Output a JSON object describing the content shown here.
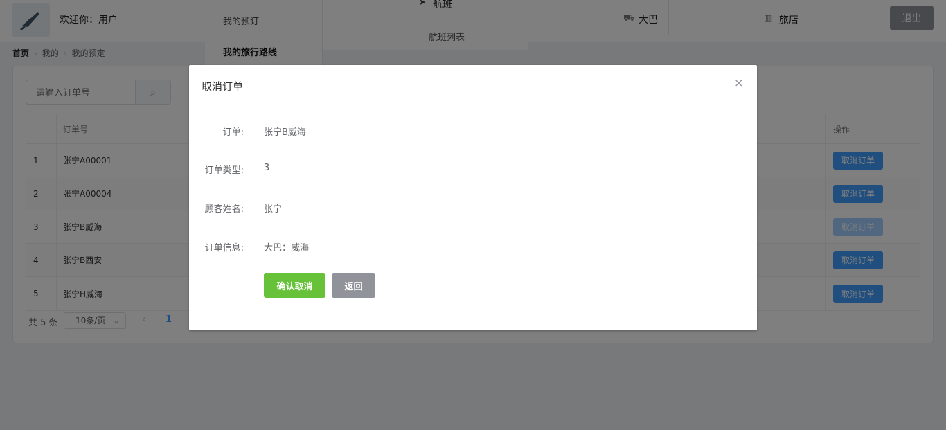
{
  "header": {
    "welcome": "欢迎你：用户",
    "nav": {
      "my_bookings": "我的预订",
      "my_routes": "我的旅行路线",
      "flight": "航班",
      "flight_list": "航班列表",
      "bus": "大巴",
      "hotel": "旅店"
    },
    "logout": "退出"
  },
  "breadcrumb": [
    "首页",
    "我的",
    "我的预定"
  ],
  "search": {
    "placeholder": "请输入订单号"
  },
  "table": {
    "columns": {
      "order_no": "订单号",
      "operation": "操作"
    },
    "rows": [
      {
        "idx": "1",
        "order_no": "张宁A00001",
        "action": "取消订单"
      },
      {
        "idx": "2",
        "order_no": "张宁A00004",
        "action": "取消订单"
      },
      {
        "idx": "3",
        "order_no": "张宁B威海",
        "action": "取消订单"
      },
      {
        "idx": "4",
        "order_no": "张宁B西安",
        "action": "取消订单"
      },
      {
        "idx": "5",
        "order_no": "张宁H威海",
        "action": "取消订单"
      }
    ]
  },
  "pagination": {
    "total": "共 5 条",
    "page_size": "10条/页",
    "current_page": "1"
  },
  "dialog": {
    "title": "取消订单",
    "fields": [
      {
        "label": "订单:",
        "value": "张宁B威海"
      },
      {
        "label": "订单类型:",
        "value": "3"
      },
      {
        "label": "顾客姓名:",
        "value": "张宁"
      },
      {
        "label": "订单信息:",
        "value": "大巴：威海"
      }
    ],
    "confirm": "确认取消",
    "back": "返回"
  },
  "colors": {
    "primary": "#409eff",
    "success": "#67c23a",
    "info": "#909399"
  }
}
